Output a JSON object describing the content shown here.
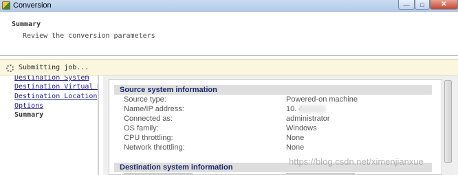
{
  "window": {
    "title": "Conversion",
    "buttons": {
      "minimize": "—",
      "maximize": "□",
      "close": "✕"
    }
  },
  "header": {
    "title": "Summary",
    "subtitle": "Review the conversion parameters"
  },
  "status": {
    "text": "Submitting job...",
    "icon": "spinner-icon"
  },
  "nav": {
    "items": [
      {
        "label": "Destination System",
        "state": "link"
      },
      {
        "label": "Destination Virtual M",
        "state": "link"
      },
      {
        "label": "Destination Location",
        "state": "link"
      },
      {
        "label": "Options",
        "state": "link"
      },
      {
        "label": "Summary",
        "state": "current"
      }
    ]
  },
  "source_section": {
    "title": "Source system information",
    "rows": [
      {
        "label": "Source type:",
        "value": "Powered-on machine"
      },
      {
        "label": "Name/IP address:",
        "value": "10.            4"
      },
      {
        "label": "Connected as:",
        "value": "administrator"
      },
      {
        "label": "OS family:",
        "value": "Windows"
      },
      {
        "label": "CPU throttling:",
        "value": "None"
      },
      {
        "label": "Network throttling:",
        "value": "None"
      }
    ]
  },
  "destination_section": {
    "title": "Destination system information"
  },
  "watermark": "https://blog.csdn.net/ximenjianxue",
  "colors": {
    "status_bg": "#fbf7df",
    "section_header_bg": "#dedede",
    "section_header_text": "#1b2a6b",
    "link": "#1a1a8c"
  }
}
